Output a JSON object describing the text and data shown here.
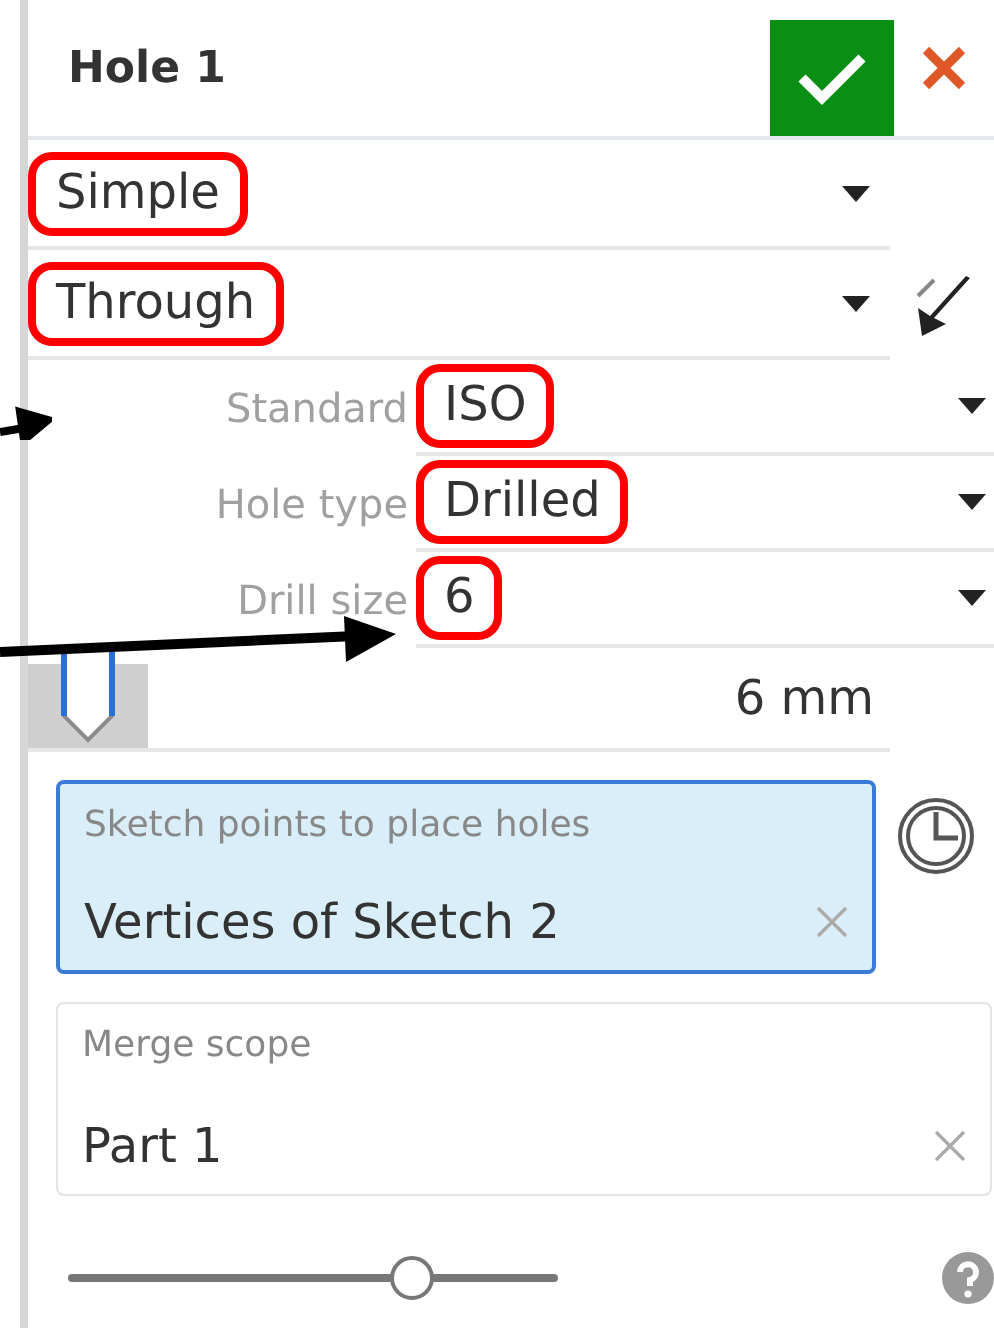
{
  "dialog": {
    "title": "Hole 1"
  },
  "selects": [
    {
      "value": "Simple",
      "highlighted": true,
      "flip": false
    },
    {
      "value": "Through",
      "highlighted": true,
      "flip": true
    }
  ],
  "parameters": [
    {
      "label": "Standard",
      "value": "ISO",
      "highlighted": true,
      "kind": "arrow-short"
    },
    {
      "label": "Hole type",
      "value": "Drilled",
      "highlighted": true,
      "kind": "plain"
    },
    {
      "label": "Drill size",
      "value": "6",
      "highlighted": true,
      "kind": "arrow-long"
    }
  ],
  "depth": {
    "value": "6 mm"
  },
  "sketch_points": {
    "label": "Sketch points to place holes",
    "value": "Vertices of Sketch 2",
    "selected": true
  },
  "merge_scope": {
    "label": "Merge scope",
    "value": "Part 1",
    "selected": false
  },
  "slider": {
    "level": 0.7
  }
}
